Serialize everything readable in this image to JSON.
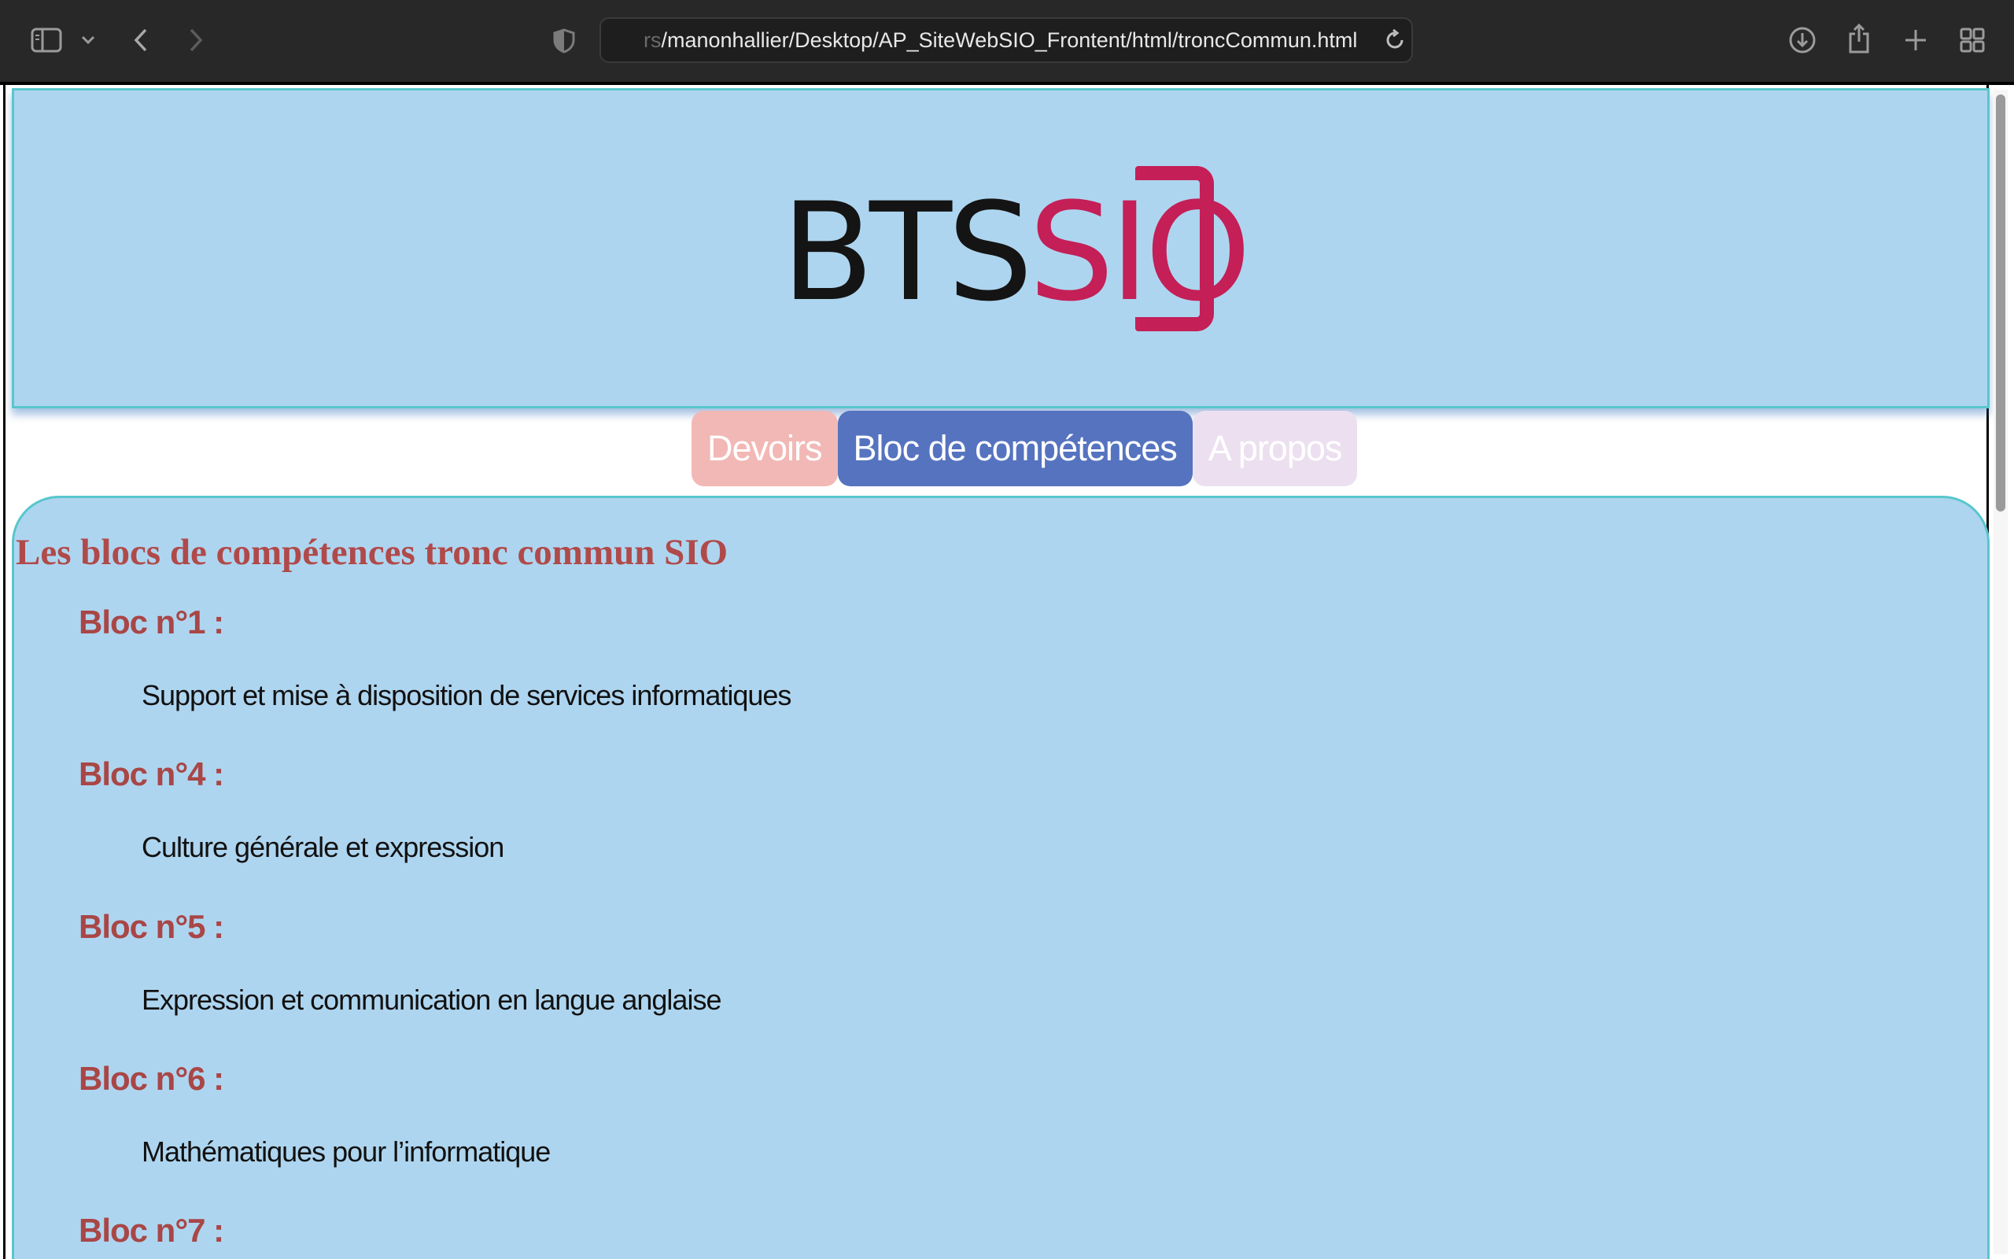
{
  "browser": {
    "url_prefix": "rs",
    "url_main": "/manonhallier/Desktop/AP_SiteWebSIO_Frontent/html/troncCommun.html"
  },
  "logo": {
    "bts": "BTS",
    "sio": "SIO"
  },
  "nav": {
    "devoirs": "Devoirs",
    "bloc": "Bloc de compétences",
    "apropos": "A propos"
  },
  "content": {
    "title": "Les blocs de compétences tronc commun SIO",
    "blocs": [
      {
        "title": "Bloc n°1 :",
        "desc": "Support et mise à disposition de services informatiques"
      },
      {
        "title": "Bloc n°4 :",
        "desc": "Culture générale et expression"
      },
      {
        "title": "Bloc n°5 :",
        "desc": "Expression et communication en langue anglaise"
      },
      {
        "title": "Bloc n°6 :",
        "desc": "Mathématiques pour l’informatique"
      },
      {
        "title": "Bloc n°7 :",
        "desc": ""
      }
    ]
  },
  "colors": {
    "header_bg": "#aed5ef",
    "border_accent": "#58c6cd",
    "heading": "#b04a4a",
    "nav_devoirs": "#f2b8b5",
    "nav_bloc": "#5573bf",
    "nav_apropos": "#ece0f0",
    "logo_red": "#c41f57"
  },
  "icons": [
    "sidebar-icon",
    "chevron-down-icon",
    "back-icon",
    "forward-icon",
    "shield-icon",
    "reload-icon",
    "download-icon",
    "share-icon",
    "new-tab-icon",
    "tab-overview-icon"
  ]
}
